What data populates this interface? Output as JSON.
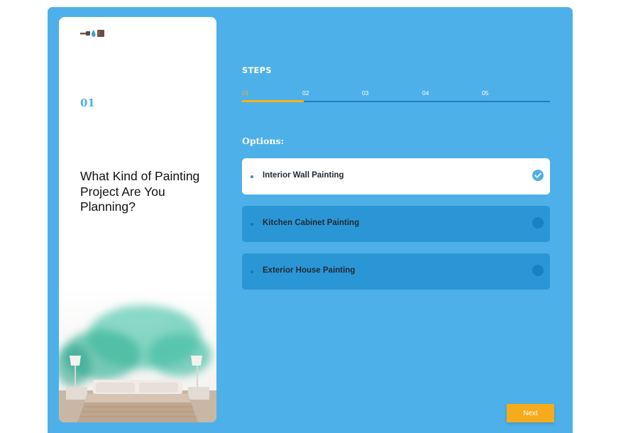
{
  "quiz": {
    "step_number": "01",
    "question": "What Kind of Painting Project Are You Planning?",
    "icons": [
      "paint-tools-logo-icon",
      "check-circle-icon"
    ]
  },
  "steps": {
    "title": "STEPS",
    "labels": [
      "01",
      "02",
      "03",
      "04",
      "05"
    ],
    "current": 1,
    "progress_fraction": 0.2
  },
  "options": {
    "title": "Options:",
    "items": [
      {
        "label": "Interior Wall Painting",
        "selected": true
      },
      {
        "label": "Kitchen Cabinet Painting",
        "selected": false
      },
      {
        "label": "Exterior House Painting",
        "selected": false
      }
    ]
  },
  "actions": {
    "next_label": "Next"
  },
  "colors": {
    "panel_blue": "#4eb0e8",
    "option_blue": "#2b96d6",
    "accent_yellow": "#f5b318",
    "next_orange": "#f5ab1b"
  }
}
